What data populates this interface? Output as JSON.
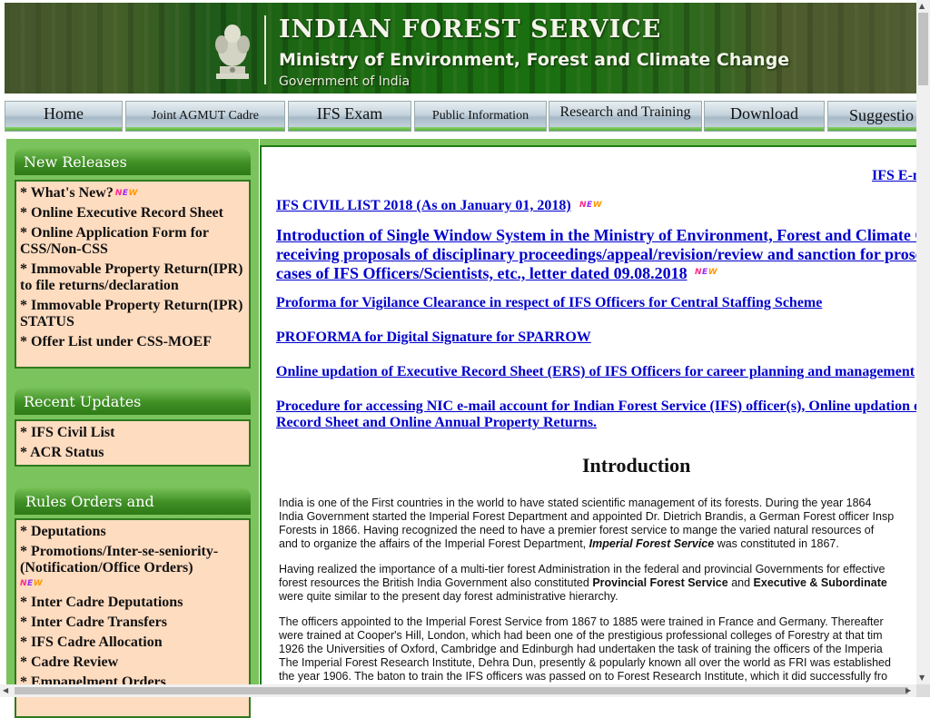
{
  "banner": {
    "title": "INDIAN FOREST SERVICE",
    "subtitle": "Ministry of Environment, Forest and Climate Change",
    "government": "Government of India"
  },
  "nav": [
    {
      "label": "Home"
    },
    {
      "label": "Joint AGMUT Cadre"
    },
    {
      "label": "IFS Exam"
    },
    {
      "label": "Public Information"
    },
    {
      "label": "Research and Training"
    },
    {
      "label": "Download"
    },
    {
      "label": "Suggestio"
    }
  ],
  "new_badge": {
    "n": "N",
    "e": "E",
    "w": "W"
  },
  "sidebar": {
    "new_releases": {
      "title": "New Releases",
      "items": [
        {
          "label": "* What's New?"
        },
        {
          "label": "* Online Executive Record Sheet"
        },
        {
          "label": "* Online Application Form for CSS/Non-CSS"
        },
        {
          "label": "* Immovable Property Return(IPR) to file returns/declaration"
        },
        {
          "label": "* Immovable Property Return(IPR) STATUS"
        },
        {
          "label": "* Offer List under CSS-MOEF"
        }
      ]
    },
    "recent_updates": {
      "title": "Recent Updates",
      "items": [
        {
          "label": "* IFS Civil List"
        },
        {
          "label": "* ACR Status"
        }
      ]
    },
    "rules": {
      "title": "Rules Orders and Notifications",
      "items": [
        {
          "label": "* Deputations"
        },
        {
          "label": "* Promotions/Inter-se-seniority-(Notification/Office Orders)"
        },
        {
          "label": "* Inter Cadre Deputations"
        },
        {
          "label": "* Inter Cadre Transfers"
        },
        {
          "label": "* IFS Cadre Allocation"
        },
        {
          "label": "* Cadre Review"
        },
        {
          "label": "* Empanelment Orders"
        }
      ]
    }
  },
  "main": {
    "email_link": "IFS E-m",
    "links": [
      "IFS CIVIL LIST 2018 (As on January 01, 2018)",
      "Introduction of Single Window System in the Ministry of Environment, Forest and Climate C",
      "receiving proposals of disciplinary proceedings/appeal/revision/review and sanction for prose",
      "cases of IFS Officers/Scientists, etc., letter dated 09.08.2018",
      "Proforma for Vigilance Clearance in respect of IFS Officers for Central Staffing Scheme",
      "PROFORMA for Digital Signature for SPARROW",
      "Online updation of Executive Record Sheet (ERS) of IFS Officers for career planning and management",
      "Procedure for accessing NIC e-mail account for Indian Forest Service (IFS) officer(s), Online updation o",
      "Record Sheet and Online Annual Property Returns."
    ],
    "intro_title": "Introduction",
    "para1": [
      "India is one of the First countries in the world to have stated scientific management of its forests. During the year 1864",
      "India Government started the Imperial Forest Department and appointed Dr. Dietrich Brandis, a German Forest officer Insp",
      "Forests in 1866. Having recognized the need to have a premier forest service to mange the varied natural resources of",
      "and to organize the affairs of the Imperial Forest Department,",
      "Imperial Forest Service",
      "was constituted in 1867."
    ],
    "para2": [
      "Having realized the importance of a multi-tier forest Administration in the federal and provincial Governments for effective",
      "forest resources the British India Government also constituted",
      "Provincial Forest Service",
      "and",
      "Executive & Subordinate",
      "were quite similar to the present day forest administrative hierarchy."
    ],
    "para3": [
      "The officers appointed to the Imperial Forest Service from 1867 to 1885 were trained in France and Germany. Thereafter",
      "were trained at Cooper's Hill, London, which had been one of the prestigious professional colleges of Forestry at that tim",
      "1926 the Universities of Oxford, Cambridge and Edinburgh had undertaken the task of training the officers of the Imperia",
      "The Imperial Forest Research Institute, Dehra Dun, presently & popularly known all over the world as FRI was established",
      "the year 1906. The baton to train the IFS officers was passed on to Forest Research Institute, which it did successfully fro"
    ]
  }
}
